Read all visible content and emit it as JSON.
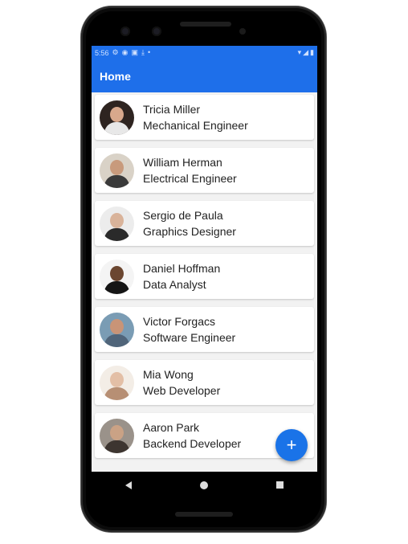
{
  "status_bar": {
    "time": "5:56",
    "icons": [
      "gear-icon",
      "notification-icon",
      "cast-icon",
      "download-icon",
      "dot-icon"
    ],
    "right_icons": [
      "wifi-icon",
      "signal-icon",
      "battery-icon"
    ]
  },
  "app_bar": {
    "title": "Home"
  },
  "contacts": [
    {
      "name": "Tricia Miller",
      "role": "Mechanical Engineer",
      "avatar_bg": "#2e2420",
      "skin": "#d8a88c",
      "cloth": "#e8e8e8"
    },
    {
      "name": "William Herman",
      "role": "Electrical Engineer",
      "avatar_bg": "#d9d2c7",
      "skin": "#c89a7c",
      "cloth": "#3a3a3a"
    },
    {
      "name": "Sergio de Paula",
      "role": "Graphics Designer",
      "avatar_bg": "#ececec",
      "skin": "#d9b39a",
      "cloth": "#2a2a2a"
    },
    {
      "name": "Daniel Hoffman",
      "role": "Data Analyst",
      "avatar_bg": "#f4f4f4",
      "skin": "#6b4630",
      "cloth": "#151515"
    },
    {
      "name": "Victor Forgacs",
      "role": "Software Engineer",
      "avatar_bg": "#7a9cb4",
      "skin": "#c99477",
      "cloth": "#50657a"
    },
    {
      "name": "Mia Wong",
      "role": "Web Developer",
      "avatar_bg": "#f3ede6",
      "skin": "#e3bfa6",
      "cloth": "#b78f74"
    },
    {
      "name": "Aaron Park",
      "role": "Backend Developer",
      "avatar_bg": "#9a928a",
      "skin": "#caa285",
      "cloth": "#3d3530"
    }
  ],
  "fab": {
    "label": "+"
  },
  "colors": {
    "primary": "#1e6fea",
    "fab": "#1a73e8",
    "background": "#f2f2f2"
  }
}
